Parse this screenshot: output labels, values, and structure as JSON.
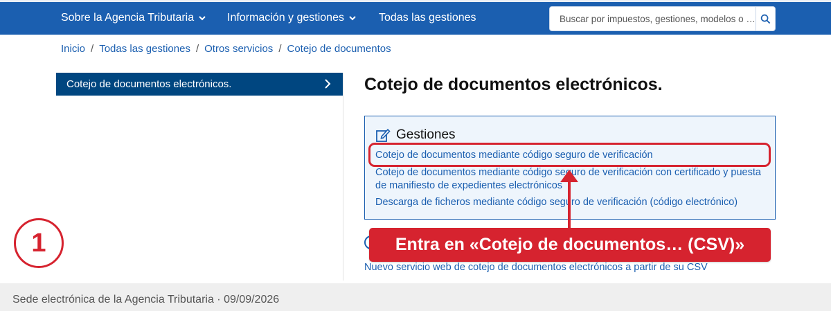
{
  "nav": {
    "items": [
      {
        "label": "Sobre la Agencia Tributaria",
        "has_dropdown": true
      },
      {
        "label": "Información y gestiones",
        "has_dropdown": true
      },
      {
        "label": "Todas las gestiones",
        "has_dropdown": false
      }
    ],
    "search_placeholder": "Buscar por impuestos, gestiones, modelos o …",
    "search_icon": "search-icon"
  },
  "breadcrumb": {
    "items": [
      "Inicio",
      "Todas las gestiones",
      "Otros servicios",
      "Cotejo de documentos"
    ],
    "separator": "/"
  },
  "sidebar": {
    "active_label": "Cotejo de documentos electrónicos."
  },
  "main": {
    "title": "Cotejo de documentos electrónicos.",
    "gestiones": {
      "heading": "Gestiones",
      "icon": "edit-icon",
      "links": [
        "Cotejo de documentos mediante código seguro de verificación",
        "Cotejo de documentos mediante código seguro de verificación con certificado y puesta de manifiesto de expedientes electrónicos",
        "Descarga de ficheros mediante código seguro de verificación (código electrónico)"
      ]
    },
    "nuevo_link": "Nuevo servicio web de cotejo de documentos electrónicos a partir de su CSV"
  },
  "annotation": {
    "callout": "Entra en «Cotejo de documentos… (CSV)»",
    "step_number": "1"
  },
  "footer": {
    "text": "Sede electrónica de la Agencia Tributaria · 09/09/2026"
  },
  "colors": {
    "brand_blue": "#1b5fb0",
    "sidebar_active": "#004680",
    "annotation_red": "#d6232f"
  }
}
